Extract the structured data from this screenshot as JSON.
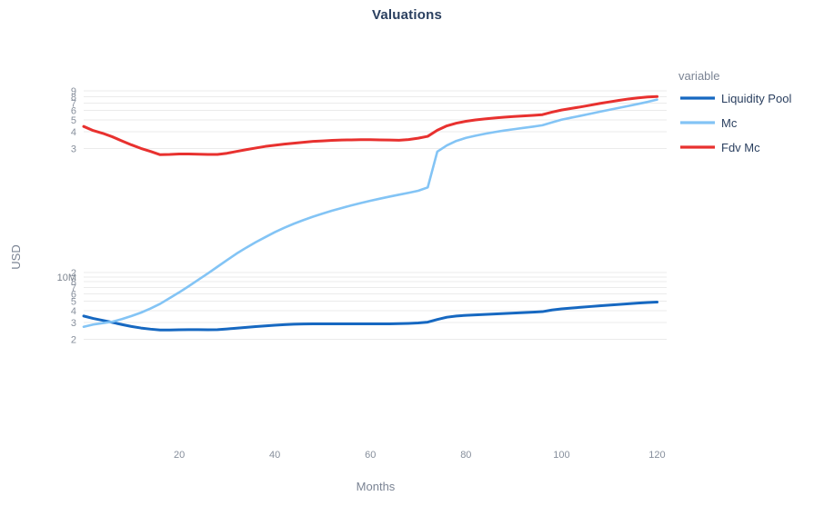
{
  "chart_data": {
    "type": "line",
    "title": "Valuations",
    "xlabel": "Months",
    "ylabel": "USD",
    "yscale": "log",
    "ylim": [
      1700000,
      85000000000
    ],
    "xlim": [
      0,
      122
    ],
    "grid": true,
    "legend_position": "right",
    "legend_title": "variable",
    "x_ticks": [
      "20",
      "40",
      "60",
      "80",
      "100",
      "120"
    ],
    "x_tick_values": [
      20,
      40,
      60,
      80,
      100,
      120
    ],
    "y_ticks": [
      "2",
      "3",
      "4",
      "5",
      "6",
      "7",
      "8",
      "10M",
      "2",
      "3",
      "4",
      "5",
      "6",
      "7",
      "8",
      "9"
    ],
    "y_tick_values": [
      2000000,
      3000000,
      4000000,
      5000000,
      6000000,
      7000000,
      8000000,
      9000000,
      10000000,
      200000000,
      300000000,
      400000000,
      500000000,
      600000000,
      700000000,
      800000000
    ],
    "x": [
      0,
      2,
      4,
      6,
      8,
      10,
      12,
      14,
      16,
      18,
      20,
      22,
      24,
      26,
      28,
      30,
      32,
      34,
      36,
      38,
      40,
      42,
      44,
      46,
      48,
      50,
      52,
      54,
      56,
      58,
      60,
      62,
      64,
      66,
      68,
      70,
      72,
      74,
      76,
      78,
      80,
      82,
      84,
      86,
      88,
      90,
      92,
      94,
      96,
      98,
      100,
      102,
      104,
      106,
      108,
      110,
      112,
      114,
      116,
      118,
      120
    ],
    "series": [
      {
        "name": "Liquidity Pool",
        "color": "#1668c1",
        "values": [
          3500000,
          3300000,
          3150000,
          3000000,
          2850000,
          2720000,
          2620000,
          2550000,
          2500000,
          2500000,
          2510000,
          2520000,
          2520000,
          2510000,
          2520000,
          2560000,
          2610000,
          2660000,
          2710000,
          2760000,
          2800000,
          2840000,
          2870000,
          2890000,
          2900000,
          2900000,
          2900000,
          2900000,
          2900000,
          2900000,
          2900000,
          2900000,
          2900000,
          2910000,
          2930000,
          2960000,
          3020000,
          3220000,
          3400000,
          3500000,
          3560000,
          3600000,
          3640000,
          3680000,
          3720000,
          3760000,
          3800000,
          3840000,
          3890000,
          4050000,
          4160000,
          4240000,
          4320000,
          4400000,
          4480000,
          4550000,
          4630000,
          4700000,
          4780000,
          4850000,
          4900000
        ]
      },
      {
        "name": "Mc",
        "color": "#83c4f5",
        "values": [
          2700000,
          2850000,
          2950000,
          3050000,
          3250000,
          3500000,
          3800000,
          4200000,
          4700000,
          5400000,
          6200000,
          7200000,
          8400000,
          9800000,
          11500000,
          13500000,
          15800000,
          18200000,
          20800000,
          23500000,
          26500000,
          29500000,
          32500000,
          35500000,
          38500000,
          41500000,
          44500000,
          47500000,
          50500000,
          53500000,
          56500000,
          59500000,
          62500000,
          65500000,
          68500000,
          72000000,
          78000000,
          185000000,
          215000000,
          240000000,
          258000000,
          272000000,
          285000000,
          297000000,
          308000000,
          318000000,
          328000000,
          338000000,
          350000000,
          375000000,
          400000000,
          420000000,
          440000000,
          462000000,
          485000000,
          508000000,
          532000000,
          558000000,
          585000000,
          615000000,
          650000000
        ]
      },
      {
        "name": "Fdv Mc",
        "color": "#e8312f",
        "values": [
          340000000,
          308000000,
          288000000,
          265000000,
          240000000,
          218000000,
          200000000,
          186000000,
          172000000,
          173000000,
          175000000,
          175000000,
          174000000,
          173000000,
          173000000,
          178000000,
          186000000,
          194000000,
          202000000,
          210000000,
          216000000,
          222000000,
          227000000,
          232000000,
          237000000,
          240000000,
          243000000,
          245000000,
          246000000,
          247000000,
          247000000,
          246000000,
          245000000,
          244000000,
          248000000,
          256000000,
          268000000,
          310000000,
          345000000,
          368000000,
          385000000,
          398000000,
          408000000,
          417000000,
          425000000,
          432000000,
          438000000,
          444000000,
          452000000,
          480000000,
          505000000,
          525000000,
          545000000,
          568000000,
          592000000,
          615000000,
          638000000,
          660000000,
          678000000,
          692000000,
          700000000
        ]
      }
    ]
  }
}
